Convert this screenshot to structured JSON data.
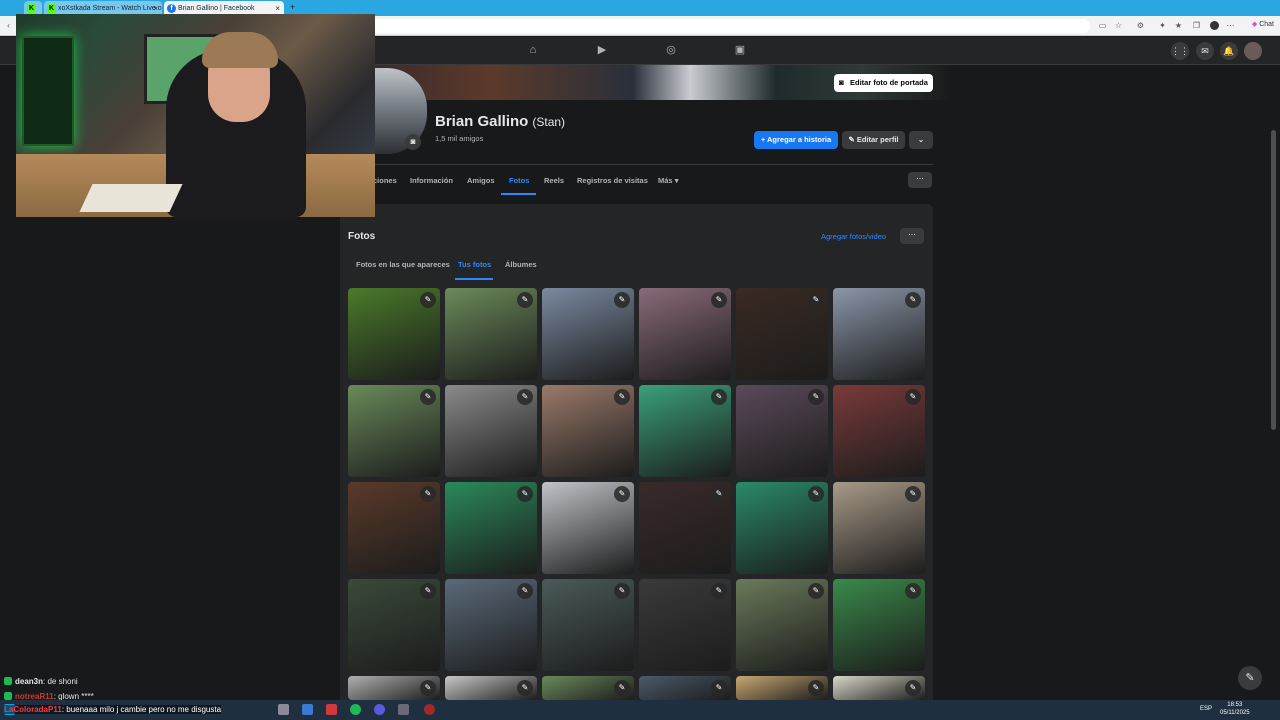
{
  "browser": {
    "tabs": [
      {
        "label": "",
        "favicon": "K"
      },
      {
        "label": "xoXstkada Stream - Watch Live o",
        "favicon": "K"
      },
      {
        "label": "Brian Gallino | Facebook",
        "favicon": "f"
      }
    ],
    "chat_label": "Chat"
  },
  "profile": {
    "name": "Brian Gallino",
    "alt_name": "(Stan)",
    "friends": "1,5 mil amigos",
    "edit_cover": "Editar foto de portada",
    "add_story": "Agregar a historia",
    "edit_profile": "Editar perfil",
    "tabs": [
      "ciones",
      "Información",
      "Amigos",
      "Fotos",
      "Reels",
      "Registros de visitas",
      "Más"
    ],
    "selected_tab": "Fotos"
  },
  "photos": {
    "title": "Fotos",
    "add_link": "Agregar fotos/video",
    "subtabs": [
      "Fotos en las que apareces",
      "Tus fotos",
      "Álbumes"
    ],
    "selected_subtab": "Tus fotos",
    "grid_colors": [
      [
        "#4a7a2a",
        "#6b8a5a",
        "#7a8aa0",
        "#8a6a7a",
        "#3a2a22",
        "#8a96a8"
      ],
      [
        "#6a8a5a",
        "#8a8a8a",
        "#9a7a6a",
        "#3aa07a",
        "#5a4a5a",
        "#7a3a3a"
      ],
      [
        "#5a3a2a",
        "#2a8a5a",
        "#c0c4c8",
        "#3a2a2a",
        "#2a8a6a",
        "#a89a88"
      ],
      [
        "#3a4a3a",
        "#5a6a7a",
        "#4a5a5a",
        "#3a3a3a",
        "#6a7a5a",
        "#3a8a4a"
      ],
      [
        "#b0b0b0",
        "#c8c8c8",
        "#6a8a5a",
        "#4a5a6a",
        "#c8a870",
        "#d8d8c8"
      ]
    ]
  },
  "chat": [
    {
      "user": "dean3n",
      "message": ": de shoni"
    },
    {
      "user": "notreaR11",
      "message": ": glown ****"
    },
    {
      "user": "LaColoradaP11",
      "message": ": buenaaa milo j cambie pero no me disgusta"
    }
  ],
  "taskbar": {
    "lang": "ESP",
    "time": "18:53",
    "date": "05/11/2025"
  }
}
